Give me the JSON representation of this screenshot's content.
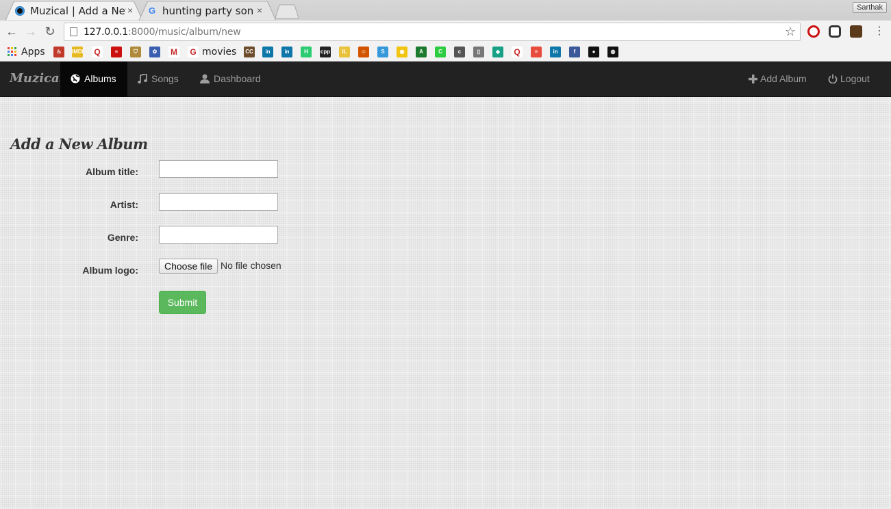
{
  "browser": {
    "tabs": [
      {
        "title": "Muzical | Add a New",
        "active": true,
        "icon": "muzical-favicon",
        "close": "×"
      },
      {
        "title": "hunting party song",
        "active": false,
        "icon": "google-favicon",
        "close": "×"
      }
    ],
    "profile_name": "Sarthak",
    "url_host": "127.0.0.1",
    "url_rest": ":8000/music/album/new",
    "back_glyph": "←",
    "forward_glyph": "→",
    "reload_glyph": "↻",
    "star_glyph": "☆",
    "menu_glyph": "⋮"
  },
  "bookmarks": {
    "apps_label": "Apps",
    "movies_label": "movies",
    "icons": [
      {
        "name": "pdf-icon",
        "color": "#c0392b",
        "glyph": "♨"
      },
      {
        "name": "imdb-icon",
        "color": "#e6b91e",
        "glyph": "IMDb"
      },
      {
        "name": "quora-icon",
        "color": "#ffffff",
        "glyph": "Q"
      },
      {
        "name": "opera-bookmark-icon",
        "color": "#cc1010",
        "glyph": "≡"
      },
      {
        "name": "shield-bookmark-icon",
        "color": "#b08a3a",
        "glyph": "⛉"
      },
      {
        "name": "puzzle-bookmark-icon",
        "color": "#3a5fb0",
        "glyph": "✿"
      },
      {
        "name": "gmail-icon",
        "color": "#ffffff",
        "glyph": "M"
      },
      {
        "name": "google-icon",
        "color": "#ffffff",
        "glyph": "G"
      },
      {
        "name": "cc-icon",
        "color": "#6d4c2b",
        "glyph": "CC"
      },
      {
        "name": "linkedin-icon",
        "color": "#0e76a8",
        "glyph": "in"
      },
      {
        "name": "linkedin-icon",
        "color": "#0e76a8",
        "glyph": "in"
      },
      {
        "name": "hackerearth-icon",
        "color": "#2ecc71",
        "glyph": "H"
      },
      {
        "name": "cpp-icon",
        "color": "#222222",
        "glyph": "cpp"
      },
      {
        "name": "il-icon",
        "color": "#e8c23a",
        "glyph": "IL"
      },
      {
        "name": "character-icon",
        "color": "#d35400",
        "glyph": "☺"
      },
      {
        "name": "sync-icon",
        "color": "#3498db",
        "glyph": "S"
      },
      {
        "name": "bulb-icon",
        "color": "#f1c40f",
        "glyph": "◉"
      },
      {
        "name": "terminal-icon",
        "color": "#1b7a2e",
        "glyph": "A"
      },
      {
        "name": "codechef-icon",
        "color": "#2ecc40",
        "glyph": "C"
      },
      {
        "name": "c-icon",
        "color": "#555555",
        "glyph": "c"
      },
      {
        "name": "document-icon",
        "color": "#777777",
        "glyph": "▯"
      },
      {
        "name": "gem-icon",
        "color": "#16a085",
        "glyph": "◈"
      },
      {
        "name": "quora-icon",
        "color": "#ffffff",
        "glyph": "Q"
      },
      {
        "name": "pen-icon",
        "color": "#e74c3c",
        "glyph": "≡"
      },
      {
        "name": "linkedin-icon",
        "color": "#0e76a8",
        "glyph": "in"
      },
      {
        "name": "facebook-icon",
        "color": "#3b5998",
        "glyph": "f"
      },
      {
        "name": "muzical-icon",
        "color": "#111111",
        "glyph": "●"
      },
      {
        "name": "github-icon",
        "color": "#111111",
        "glyph": "◍"
      }
    ]
  },
  "navbar": {
    "brand": "Muzicall",
    "albums_label": "Albums",
    "songs_label": "Songs",
    "dashboard_label": "Dashboard",
    "add_album_label": "Add Album",
    "logout_label": "Logout"
  },
  "form": {
    "heading": "Add a New Album",
    "album_title_label": "Album title:",
    "artist_label": "Artist:",
    "genre_label": "Genre:",
    "album_logo_label": "Album logo:",
    "choose_file_label": "Choose file",
    "file_status": "No file chosen",
    "album_title_value": "",
    "artist_value": "",
    "genre_value": "",
    "submit_label": "Submit"
  },
  "colors": {
    "navbar_bg": "#222222",
    "submit_bg": "#5cb85c",
    "opera_red": "#cc1010"
  }
}
